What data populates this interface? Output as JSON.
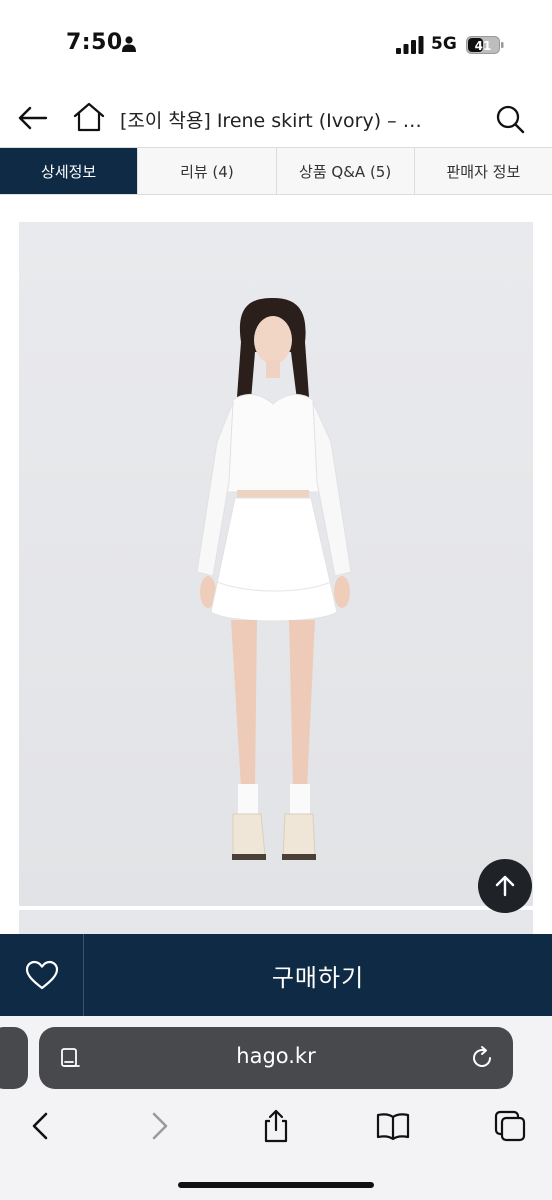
{
  "status_bar": {
    "time": "7:50",
    "network": "5G",
    "battery": "41",
    "icons": [
      "person-icon",
      "signal-icon",
      "battery-icon"
    ]
  },
  "header": {
    "title": "[조이 착용] Irene skirt (Ivory) – …",
    "icons": [
      "back-arrow-icon",
      "home-icon",
      "search-icon"
    ]
  },
  "tabs": [
    {
      "label": "상세정보",
      "active": true
    },
    {
      "label": "리뷰 (4)",
      "active": false
    },
    {
      "label": "상품 Q&A (5)",
      "active": false
    },
    {
      "label": "판매자 정보",
      "active": false
    }
  ],
  "product_image": {
    "description_icon": "product-photo"
  },
  "buy_bar": {
    "buy_label": "구매하기",
    "like_icon": "heart-icon"
  },
  "browser": {
    "url": "hago.kr",
    "toolbar_icons": [
      "back-icon",
      "forward-icon",
      "share-icon",
      "bookmarks-icon",
      "tabs-icon"
    ]
  },
  "colors": {
    "navy": "#0f2a44",
    "tab_bg": "#f7f7f7",
    "photo_bg": "#e6e7ea",
    "url_bar": "#48494d"
  }
}
